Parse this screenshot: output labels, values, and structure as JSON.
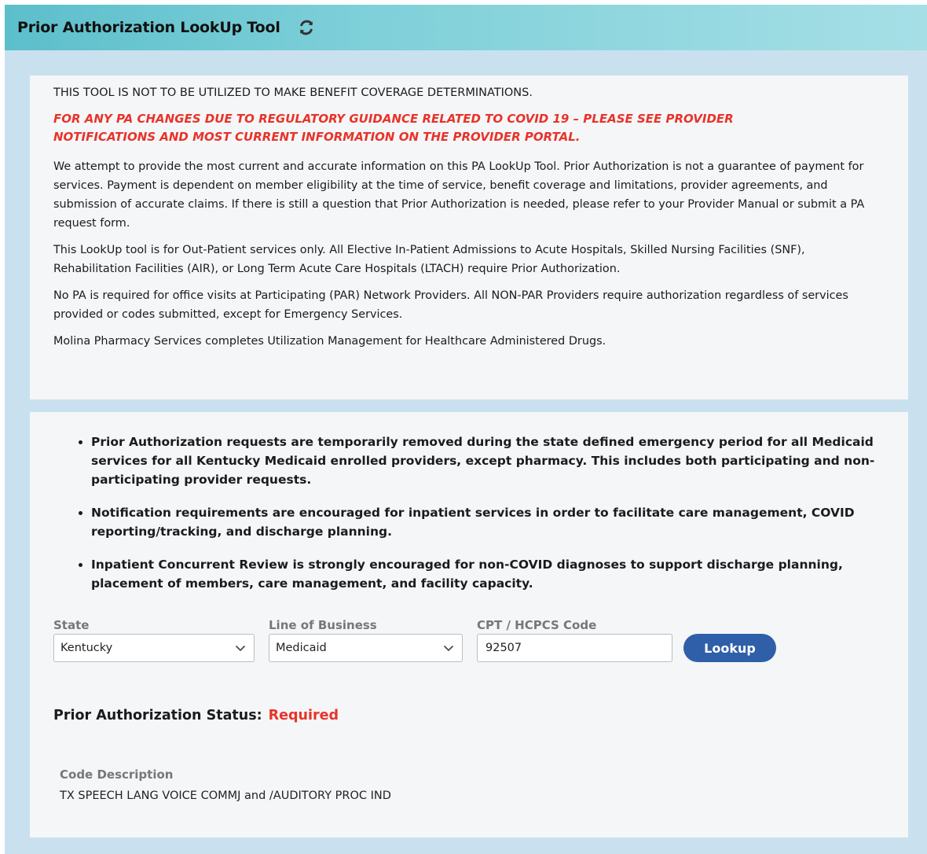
{
  "header": {
    "title": "Prior Authorization LookUp Tool",
    "refresh_icon": "refresh-icon"
  },
  "notice": {
    "disclaimer": "THIS TOOL IS NOT TO BE UTILIZED TO MAKE BENEFIT COVERAGE DETERMINATIONS.",
    "covid_alert": "FOR ANY PA CHANGES DUE TO REGULATORY GUIDANCE RELATED TO COVID 19 – PLEASE SEE PROVIDER NOTIFICATIONS AND MOST CURRENT INFORMATION ON THE PROVIDER PORTAL.",
    "paragraphs": [
      "We attempt to provide the most current and accurate information on this PA LookUp Tool. Prior Authorization is not a guarantee of payment for services. Payment is dependent on member eligibility at the time of service, benefit coverage and limitations, provider agreements, and submission of accurate claims. If there is still a question that Prior Authorization is needed, please refer to your Provider Manual or submit a PA request form.",
      "This LookUp tool is for Out-Patient services only. All Elective In-Patient Admissions to Acute Hospitals, Skilled Nursing Facilities (SNF), Rehabilitation Facilities (AIR), or Long Term Acute Care Hospitals (LTACH) require Prior Authorization.",
      "No PA is required for office visits at Participating (PAR) Network Providers. All NON-PAR Providers require authorization regardless of services provided or codes submitted, except for Emergency Services.",
      "Molina Pharmacy Services completes Utilization Management for Healthcare Administered Drugs."
    ]
  },
  "bullets": [
    "Prior Authorization requests are temporarily removed during the state defined emergency period for all Medicaid services for all Kentucky Medicaid enrolled providers, except pharmacy.  This includes both participating and non-participating provider requests.",
    "Notification requirements are encouraged for inpatient services in order to facilitate care management, COVID reporting/tracking, and discharge planning.",
    "Inpatient Concurrent Review is strongly encouraged for non-COVID diagnoses to support discharge planning, placement of members, care management, and facility capacity."
  ],
  "form": {
    "state_label": "State",
    "state_value": "Kentucky",
    "lob_label": "Line of Business",
    "lob_value": "Medicaid",
    "code_label": "CPT / HCPCS Code",
    "code_value": "92507",
    "lookup_label": "Lookup"
  },
  "result": {
    "status_label": "Prior Authorization Status:",
    "status_value": "Required",
    "status_color": "#e8332a",
    "desc_label": "Code Description",
    "desc_value": "TX SPEECH LANG VOICE COMMJ and /AUDITORY PROC IND"
  }
}
